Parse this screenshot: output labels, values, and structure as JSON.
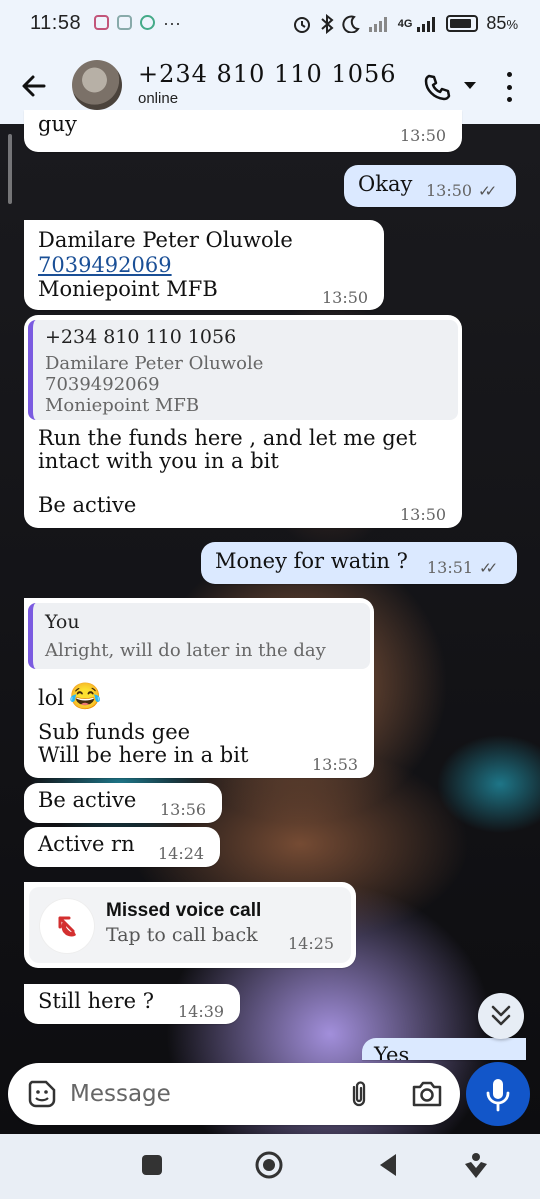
{
  "status_bar": {
    "time": "11:58",
    "more": "···",
    "net_label": "4G",
    "battery": "85",
    "battery_unit": "%",
    "battery_level": 0.85
  },
  "header": {
    "contact_name": "+234 810 110 1056",
    "status": "online"
  },
  "messages": {
    "m0": {
      "text": "guy",
      "time": "13:50"
    },
    "m1": {
      "text": "Okay",
      "time": "13:50"
    },
    "m2": {
      "line1": "Damilare Peter Oluwole",
      "link": "7039492069",
      "line3": "Moniepoint MFB",
      "time": "13:50"
    },
    "m3": {
      "quote": {
        "name": "+234 810 110 1056",
        "line1": "Damilare Peter Oluwole",
        "line2": "7039492069",
        "line3": "Moniepoint MFB"
      },
      "line1": "Run the funds here ,  and let me get",
      "line2": "intact with you in a bit",
      "line3": "Be active",
      "time": "13:50"
    },
    "m4": {
      "text": "Money for watin ?",
      "time": "13:51"
    },
    "m5": {
      "quote": {
        "name": "You",
        "text": "Alright, will do later in the day"
      },
      "line1": "lol",
      "emoji": "😂",
      "line2": "Sub funds gee",
      "line3": "Will be here in a bit",
      "time": "13:53"
    },
    "m6": {
      "text": "Be active",
      "time": "13:56"
    },
    "m7": {
      "text": "Active rn",
      "time": "14:24"
    },
    "m8": {
      "title": "Missed voice call",
      "subtitle": "Tap to call back",
      "time": "14:25"
    },
    "m9": {
      "text": "Still here ?",
      "time": "14:39"
    },
    "m10": {
      "text": "Yes"
    }
  },
  "composer": {
    "placeholder": "Message"
  },
  "colors": {
    "incoming": "#ffffff",
    "outgoing": "#dbe9ff",
    "accent": "#1256c9",
    "missed": "#d32f2f",
    "quote_bar": "#7b5be0"
  }
}
